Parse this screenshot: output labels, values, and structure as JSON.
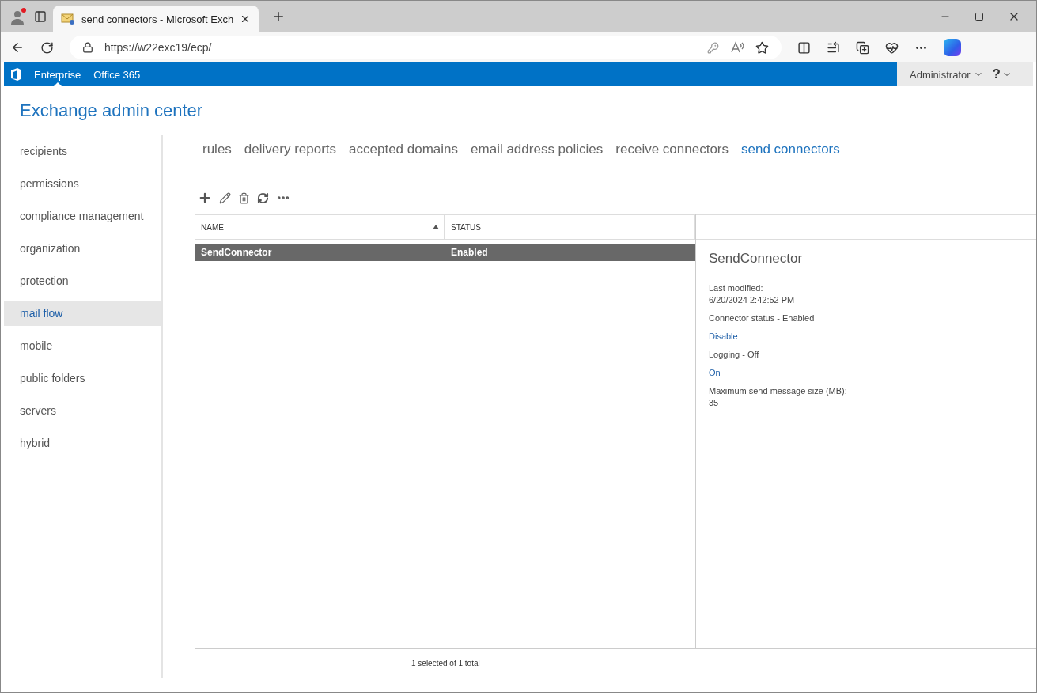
{
  "browser": {
    "tab_title": "send connectors - Microsoft Exch",
    "url": "https://w22exc19/ecp/"
  },
  "app_bar": {
    "links": [
      {
        "label": "Enterprise",
        "selected": true
      },
      {
        "label": "Office 365",
        "selected": false
      }
    ],
    "user": "Administrator",
    "help": "?"
  },
  "title": "Exchange admin center",
  "sidebar": {
    "items": [
      {
        "label": "recipients",
        "selected": false
      },
      {
        "label": "permissions",
        "selected": false
      },
      {
        "label": "compliance management",
        "selected": false
      },
      {
        "label": "organization",
        "selected": false
      },
      {
        "label": "protection",
        "selected": false
      },
      {
        "label": "mail flow",
        "selected": true
      },
      {
        "label": "mobile",
        "selected": false
      },
      {
        "label": "public folders",
        "selected": false
      },
      {
        "label": "servers",
        "selected": false
      },
      {
        "label": "hybrid",
        "selected": false
      }
    ]
  },
  "tabs": [
    {
      "label": "rules",
      "selected": false
    },
    {
      "label": "delivery reports",
      "selected": false
    },
    {
      "label": "accepted domains",
      "selected": false
    },
    {
      "label": "email address policies",
      "selected": false
    },
    {
      "label": "receive connectors",
      "selected": false
    },
    {
      "label": "send connectors",
      "selected": true
    }
  ],
  "table": {
    "columns": [
      {
        "label": "NAME",
        "sorted": true
      },
      {
        "label": "STATUS",
        "sorted": false
      }
    ],
    "rows": [
      {
        "cells": [
          "SendConnector",
          "Enabled"
        ],
        "selected": true
      }
    ]
  },
  "details": {
    "title": "SendConnector",
    "entries": [
      {
        "kind": "label",
        "text": "Last modified:"
      },
      {
        "kind": "value",
        "text": "6/20/2024 2:42:52 PM"
      },
      {
        "kind": "label",
        "text": "Connector status - Enabled"
      },
      {
        "kind": "link",
        "text": "Disable"
      },
      {
        "kind": "label",
        "text": "Logging - Off"
      },
      {
        "kind": "link",
        "text": "On"
      },
      {
        "kind": "label",
        "text": "Maximum send message size (MB):"
      },
      {
        "kind": "value",
        "text": "35"
      }
    ]
  },
  "status_bar": "1 selected of 1 total"
}
